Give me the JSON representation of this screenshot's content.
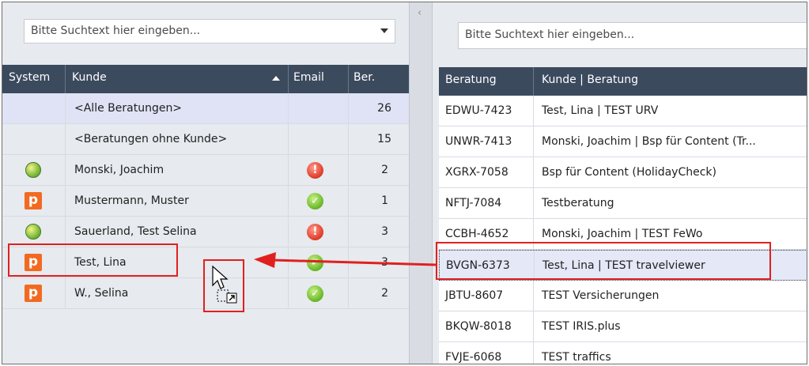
{
  "left": {
    "search_placeholder": "Bitte Suchtext hier eingeben...",
    "columns": {
      "system": "System",
      "kunde": "Kunde",
      "email": "Email",
      "ber": "Ber."
    },
    "rows": [
      {
        "system": "",
        "kunde": "<Alle Beratungen>",
        "email": "",
        "ber": "26"
      },
      {
        "system": "",
        "kunde": "<Beratungen ohne Kunde>",
        "email": "",
        "ber": "15"
      },
      {
        "system": "globe-icon",
        "kunde": "Monski, Joachim",
        "email": "error-icon",
        "ber": "2"
      },
      {
        "system": "p-logo-icon",
        "kunde": "Mustermann, Muster",
        "email": "check-icon",
        "ber": "1"
      },
      {
        "system": "globe-icon",
        "kunde": "Sauerland, Test Selina",
        "email": "error-icon",
        "ber": "3"
      },
      {
        "system": "p-logo-icon",
        "kunde": "Test, Lina",
        "email": "check-icon",
        "ber": "3"
      },
      {
        "system": "p-logo-icon",
        "kunde": "W., Selina",
        "email": "check-icon",
        "ber": "2"
      }
    ]
  },
  "right": {
    "search_placeholder": "Bitte Suchtext hier eingeben...",
    "columns": {
      "beratung": "Beratung",
      "kunde_beratung": "Kunde | Beratung"
    },
    "rows": [
      {
        "beratung": "EDWU-7423",
        "kunde_beratung": "Test, Lina | TEST URV"
      },
      {
        "beratung": "UNWR-7413",
        "kunde_beratung": "Monski, Joachim | Bsp für Content (Tr..."
      },
      {
        "beratung": "XGRX-7058",
        "kunde_beratung": "Bsp für Content (HolidayCheck)"
      },
      {
        "beratung": "NFTJ-7084",
        "kunde_beratung": "Testberatung"
      },
      {
        "beratung": "CCBH-4652",
        "kunde_beratung": "Monski, Joachim | TEST FeWo"
      },
      {
        "beratung": "BVGN-6373",
        "kunde_beratung": "Test, Lina | TEST travelviewer"
      },
      {
        "beratung": "JBTU-8607",
        "kunde_beratung": "TEST Versicherungen"
      },
      {
        "beratung": "BKQW-8018",
        "kunde_beratung": "TEST IRIS.plus"
      },
      {
        "beratung": "FVJE-6068",
        "kunde_beratung": "TEST traffics"
      }
    ]
  },
  "colors": {
    "header_bg": "#3c4a5e",
    "annotation_red": "#e02020",
    "p_logo": "#f26a21"
  }
}
